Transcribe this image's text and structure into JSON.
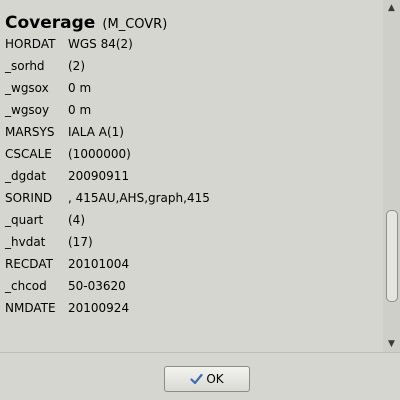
{
  "feature": {
    "title": "Coverage",
    "code": "(M_COVR)"
  },
  "attributes": [
    {
      "key": "HORDAT",
      "value": "WGS 84(2)"
    },
    {
      "key": "_sorhd",
      "value": "(2)"
    },
    {
      "key": "_wgsox",
      "value": "0 m"
    },
    {
      "key": "_wgsoy",
      "value": "0 m"
    },
    {
      "key": "MARSYS",
      "value": "IALA A(1)"
    },
    {
      "key": "CSCALE",
      "value": "(1000000)"
    },
    {
      "key": "_dgdat",
      "value": "20090911"
    },
    {
      "key": "SORIND",
      "value": ", 415AU,AHS,graph,415"
    },
    {
      "key": "_quart",
      "value": "(4)"
    },
    {
      "key": "_hvdat",
      "value": "(17)"
    },
    {
      "key": "RECDAT",
      "value": "20101004"
    },
    {
      "key": "_chcod",
      "value": "50-03620"
    },
    {
      "key": "NMDATE",
      "value": "20100924"
    }
  ],
  "button_bar": {
    "ok_label": "OK",
    "ok_icon": "checkmark-icon"
  },
  "colors": {
    "background": "#d6d6d1",
    "checkmark": "#3f6fb0"
  }
}
